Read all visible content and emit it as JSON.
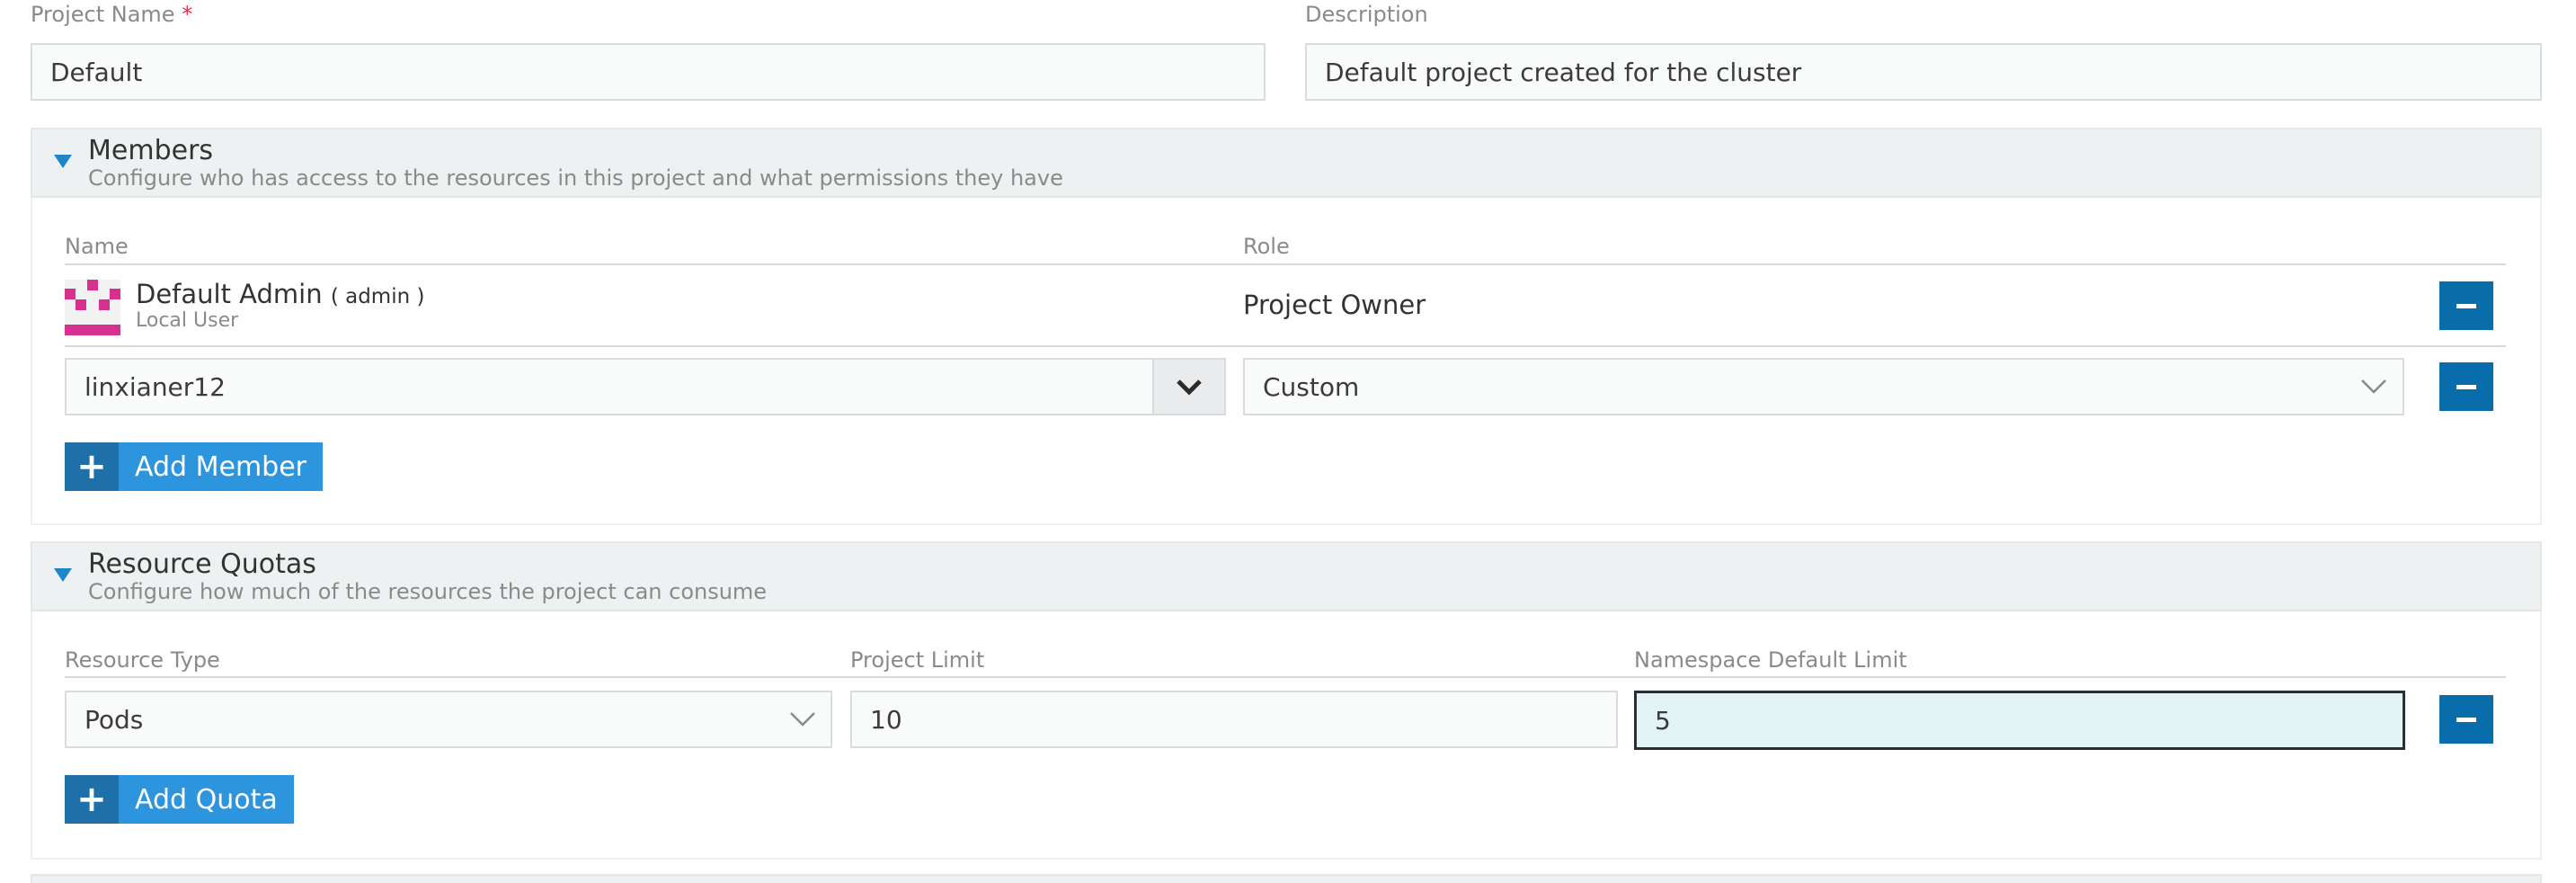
{
  "form": {
    "project_name_label": "Project Name",
    "required_mark": "*",
    "project_name_value": "Default",
    "description_label": "Description",
    "description_value": "Default project created for the cluster"
  },
  "members": {
    "title": "Members",
    "subtitle": "Configure who has access to the resources in this project and what permissions they have",
    "col_name": "Name",
    "col_role": "Role",
    "rows": [
      {
        "name": "Default Admin",
        "username": "( admin )",
        "kind": "Local User",
        "role": "Project Owner"
      }
    ],
    "new_member_value": "linxianer12",
    "new_member_role": "Custom",
    "add_label": "Add Member",
    "avatar_color": "#d7308e"
  },
  "quotas": {
    "title": "Resource Quotas",
    "subtitle": "Configure how much of the resources the project can consume",
    "col_type": "Resource Type",
    "col_project_limit": "Project Limit",
    "col_namespace_limit": "Namespace Default Limit",
    "row": {
      "type": "Pods",
      "project_limit": "10",
      "namespace_limit": "5"
    },
    "add_label": "Add Quota"
  },
  "colors": {
    "accent": "#2c95dd",
    "accent_dark": "#0a6dab",
    "required": "#e0324a"
  }
}
